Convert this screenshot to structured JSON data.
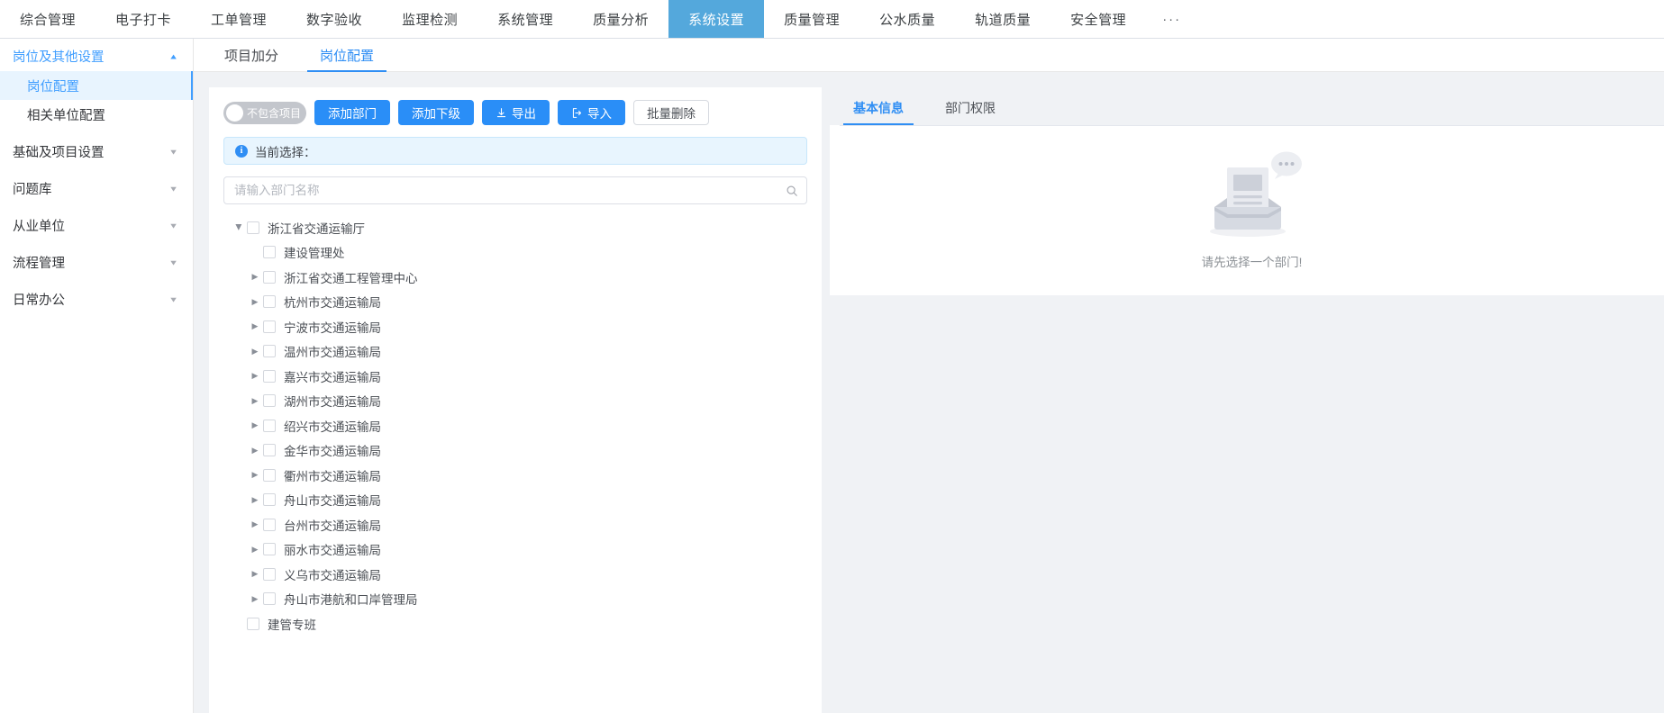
{
  "topnav": {
    "items": [
      {
        "label": "综合管理",
        "active": false
      },
      {
        "label": "电子打卡",
        "active": false
      },
      {
        "label": "工单管理",
        "active": false
      },
      {
        "label": "数字验收",
        "active": false
      },
      {
        "label": "监理检测",
        "active": false
      },
      {
        "label": "系统管理",
        "active": false
      },
      {
        "label": "质量分析",
        "active": false
      },
      {
        "label": "系统设置",
        "active": true
      },
      {
        "label": "质量管理",
        "active": false
      },
      {
        "label": "公水质量",
        "active": false
      },
      {
        "label": "轨道质量",
        "active": false
      },
      {
        "label": "安全管理",
        "active": false
      }
    ],
    "more_label": "···",
    "active_bg": "#54a8dc"
  },
  "sidebar": {
    "groups": [
      {
        "label": "岗位及其他设置",
        "expanded": true,
        "arrow": "▲"
      },
      {
        "label": "基础及项目设置",
        "expanded": false,
        "arrow": "▼"
      },
      {
        "label": "问题库",
        "expanded": false,
        "arrow": "▼"
      },
      {
        "label": "从业单位",
        "expanded": false,
        "arrow": "▼"
      },
      {
        "label": "流程管理",
        "expanded": false,
        "arrow": "▼"
      },
      {
        "label": "日常办公",
        "expanded": false,
        "arrow": "▼"
      }
    ],
    "subitems": [
      {
        "label": "岗位配置",
        "active": true
      },
      {
        "label": "相关单位配置",
        "active": false
      }
    ]
  },
  "subtabs": [
    {
      "label": "项目加分",
      "active": false
    },
    {
      "label": "岗位配置",
      "active": true
    }
  ],
  "toolbar": {
    "switch_label": "不包含项目",
    "switch_on": false,
    "add_dept_label": "添加部门",
    "add_child_label": "添加下级",
    "export_label": "导出",
    "import_label": "导入",
    "batch_delete_label": "批量删除"
  },
  "alert": {
    "text": "当前选择：",
    "icon": "info-icon",
    "bg": "#e8f5fe"
  },
  "search": {
    "placeholder": "请输入部门名称",
    "value": "",
    "icon": "search-icon"
  },
  "tree": [
    {
      "label": "浙江省交通运输厅",
      "indent": 0,
      "caret": "down",
      "checked": false
    },
    {
      "label": "建设管理处",
      "indent": 1,
      "caret": "none",
      "checked": false
    },
    {
      "label": "浙江省交通工程管理中心",
      "indent": 1,
      "caret": "right",
      "checked": false
    },
    {
      "label": "杭州市交通运输局",
      "indent": 1,
      "caret": "right",
      "checked": false
    },
    {
      "label": "宁波市交通运输局",
      "indent": 1,
      "caret": "right",
      "checked": false
    },
    {
      "label": "温州市交通运输局",
      "indent": 1,
      "caret": "right",
      "checked": false
    },
    {
      "label": "嘉兴市交通运输局",
      "indent": 1,
      "caret": "right",
      "checked": false
    },
    {
      "label": "湖州市交通运输局",
      "indent": 1,
      "caret": "right",
      "checked": false
    },
    {
      "label": "绍兴市交通运输局",
      "indent": 1,
      "caret": "right",
      "checked": false
    },
    {
      "label": "金华市交通运输局",
      "indent": 1,
      "caret": "right",
      "checked": false
    },
    {
      "label": "衢州市交通运输局",
      "indent": 1,
      "caret": "right",
      "checked": false
    },
    {
      "label": "舟山市交通运输局",
      "indent": 1,
      "caret": "right",
      "checked": false
    },
    {
      "label": "台州市交通运输局",
      "indent": 1,
      "caret": "right",
      "checked": false
    },
    {
      "label": "丽水市交通运输局",
      "indent": 1,
      "caret": "right",
      "checked": false
    },
    {
      "label": "义乌市交通运输局",
      "indent": 1,
      "caret": "right",
      "checked": false
    },
    {
      "label": "舟山市港航和口岸管理局",
      "indent": 1,
      "caret": "right",
      "checked": false
    },
    {
      "label": "建管专班",
      "indent": 0,
      "caret": "none",
      "checked": false
    }
  ],
  "detail": {
    "tabs": [
      {
        "label": "基本信息",
        "active": true
      },
      {
        "label": "部门权限",
        "active": false
      }
    ],
    "empty_text": "请先选择一个部门!",
    "empty_icon": "empty-inbox-icon"
  },
  "colors": {
    "primary": "#2a8ef7",
    "nav_active": "#54a8dc",
    "page_bg": "#f0f2f5"
  }
}
